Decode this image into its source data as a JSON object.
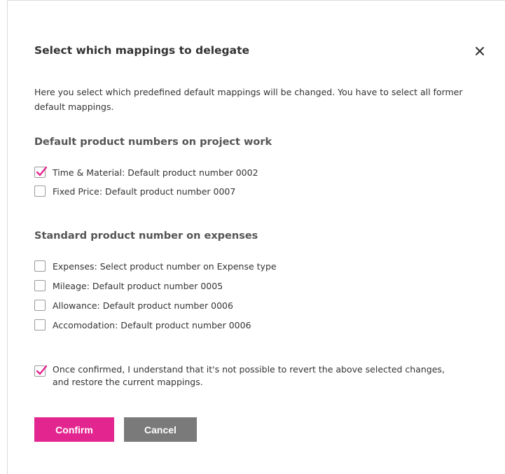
{
  "dialog": {
    "title": "Select which mappings to delegate",
    "close_icon": "close-icon",
    "intro": "Here you select which predefined default mappings will be changed. You have to select all former default mappings."
  },
  "sections": [
    {
      "title": "Default product numbers on project work",
      "options": [
        {
          "label": "Time & Material: Default product number 0002",
          "checked": true
        },
        {
          "label": "Fixed Price: Default product number 0007",
          "checked": false
        }
      ]
    },
    {
      "title": "Standard product number on expenses",
      "options": [
        {
          "label": "Expenses: Select product number on Expense type",
          "checked": false
        },
        {
          "label": "Mileage: Default product number 0005",
          "checked": false
        },
        {
          "label": "Allowance: Default product number 0006",
          "checked": false
        },
        {
          "label": "Accomodation: Default product number 0006",
          "checked": false
        }
      ]
    }
  ],
  "confirmation": {
    "text": "Once confirmed, I understand that it's not possible to revert the above selected changes, and restore the current mappings.",
    "checked": true
  },
  "buttons": {
    "confirm_label": "Confirm",
    "cancel_label": "Cancel"
  },
  "colors": {
    "accent": "#e3268f",
    "secondary_button": "#7a7a7a",
    "text": "#333333",
    "section_title": "#555555"
  }
}
